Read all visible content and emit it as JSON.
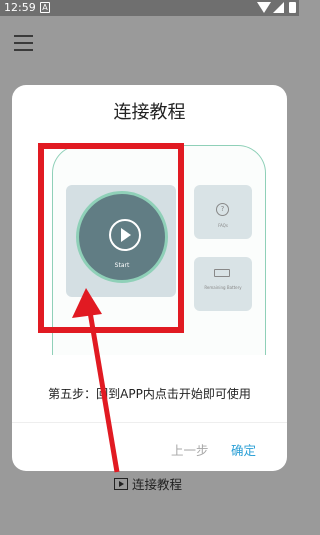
{
  "status_bar": {
    "time": "12:59",
    "notification_glyph": "A"
  },
  "app": {
    "menu_icon": "hamburger-menu-icon"
  },
  "dialog": {
    "title": "连接教程",
    "preview": {
      "start_label": "Start",
      "faq_label": "FAQs",
      "battery_label": "Remaining Battery",
      "faq_icon": "question-circle-icon",
      "battery_icon": "battery-icon",
      "start_icon": "play-circle-icon"
    },
    "step_text": "第五步：回到APP内点击开始即可使用",
    "buttons": {
      "prev": "上一步",
      "confirm": "确定"
    }
  },
  "bottom_link": {
    "label": "连接教程",
    "icon": "play-box-icon"
  },
  "colors": {
    "accent": "#2ca0d6",
    "highlight": "#e11a22",
    "mint": "#8fd0b8",
    "dim_overlay": "#9a9a9a"
  }
}
